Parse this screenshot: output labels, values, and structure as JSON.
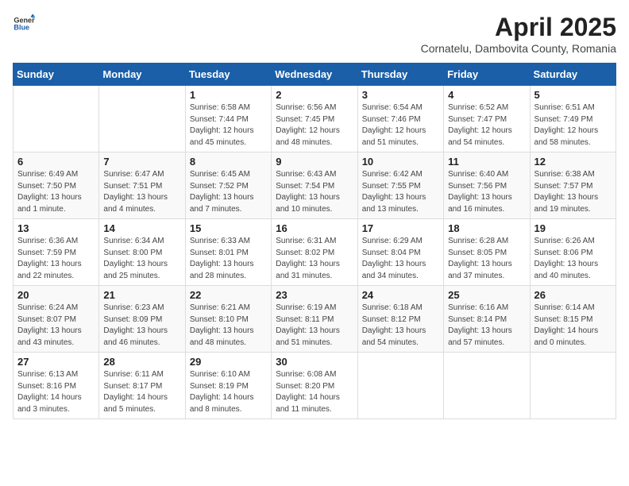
{
  "logo": {
    "general": "General",
    "blue": "Blue"
  },
  "title": {
    "month_year": "April 2025",
    "location": "Cornatelu, Dambovita County, Romania"
  },
  "weekdays": [
    "Sunday",
    "Monday",
    "Tuesday",
    "Wednesday",
    "Thursday",
    "Friday",
    "Saturday"
  ],
  "weeks": [
    [
      {
        "day": "",
        "detail": ""
      },
      {
        "day": "",
        "detail": ""
      },
      {
        "day": "1",
        "detail": "Sunrise: 6:58 AM\nSunset: 7:44 PM\nDaylight: 12 hours\nand 45 minutes."
      },
      {
        "day": "2",
        "detail": "Sunrise: 6:56 AM\nSunset: 7:45 PM\nDaylight: 12 hours\nand 48 minutes."
      },
      {
        "day": "3",
        "detail": "Sunrise: 6:54 AM\nSunset: 7:46 PM\nDaylight: 12 hours\nand 51 minutes."
      },
      {
        "day": "4",
        "detail": "Sunrise: 6:52 AM\nSunset: 7:47 PM\nDaylight: 12 hours\nand 54 minutes."
      },
      {
        "day": "5",
        "detail": "Sunrise: 6:51 AM\nSunset: 7:49 PM\nDaylight: 12 hours\nand 58 minutes."
      }
    ],
    [
      {
        "day": "6",
        "detail": "Sunrise: 6:49 AM\nSunset: 7:50 PM\nDaylight: 13 hours\nand 1 minute."
      },
      {
        "day": "7",
        "detail": "Sunrise: 6:47 AM\nSunset: 7:51 PM\nDaylight: 13 hours\nand 4 minutes."
      },
      {
        "day": "8",
        "detail": "Sunrise: 6:45 AM\nSunset: 7:52 PM\nDaylight: 13 hours\nand 7 minutes."
      },
      {
        "day": "9",
        "detail": "Sunrise: 6:43 AM\nSunset: 7:54 PM\nDaylight: 13 hours\nand 10 minutes."
      },
      {
        "day": "10",
        "detail": "Sunrise: 6:42 AM\nSunset: 7:55 PM\nDaylight: 13 hours\nand 13 minutes."
      },
      {
        "day": "11",
        "detail": "Sunrise: 6:40 AM\nSunset: 7:56 PM\nDaylight: 13 hours\nand 16 minutes."
      },
      {
        "day": "12",
        "detail": "Sunrise: 6:38 AM\nSunset: 7:57 PM\nDaylight: 13 hours\nand 19 minutes."
      }
    ],
    [
      {
        "day": "13",
        "detail": "Sunrise: 6:36 AM\nSunset: 7:59 PM\nDaylight: 13 hours\nand 22 minutes."
      },
      {
        "day": "14",
        "detail": "Sunrise: 6:34 AM\nSunset: 8:00 PM\nDaylight: 13 hours\nand 25 minutes."
      },
      {
        "day": "15",
        "detail": "Sunrise: 6:33 AM\nSunset: 8:01 PM\nDaylight: 13 hours\nand 28 minutes."
      },
      {
        "day": "16",
        "detail": "Sunrise: 6:31 AM\nSunset: 8:02 PM\nDaylight: 13 hours\nand 31 minutes."
      },
      {
        "day": "17",
        "detail": "Sunrise: 6:29 AM\nSunset: 8:04 PM\nDaylight: 13 hours\nand 34 minutes."
      },
      {
        "day": "18",
        "detail": "Sunrise: 6:28 AM\nSunset: 8:05 PM\nDaylight: 13 hours\nand 37 minutes."
      },
      {
        "day": "19",
        "detail": "Sunrise: 6:26 AM\nSunset: 8:06 PM\nDaylight: 13 hours\nand 40 minutes."
      }
    ],
    [
      {
        "day": "20",
        "detail": "Sunrise: 6:24 AM\nSunset: 8:07 PM\nDaylight: 13 hours\nand 43 minutes."
      },
      {
        "day": "21",
        "detail": "Sunrise: 6:23 AM\nSunset: 8:09 PM\nDaylight: 13 hours\nand 46 minutes."
      },
      {
        "day": "22",
        "detail": "Sunrise: 6:21 AM\nSunset: 8:10 PM\nDaylight: 13 hours\nand 48 minutes."
      },
      {
        "day": "23",
        "detail": "Sunrise: 6:19 AM\nSunset: 8:11 PM\nDaylight: 13 hours\nand 51 minutes."
      },
      {
        "day": "24",
        "detail": "Sunrise: 6:18 AM\nSunset: 8:12 PM\nDaylight: 13 hours\nand 54 minutes."
      },
      {
        "day": "25",
        "detail": "Sunrise: 6:16 AM\nSunset: 8:14 PM\nDaylight: 13 hours\nand 57 minutes."
      },
      {
        "day": "26",
        "detail": "Sunrise: 6:14 AM\nSunset: 8:15 PM\nDaylight: 14 hours\nand 0 minutes."
      }
    ],
    [
      {
        "day": "27",
        "detail": "Sunrise: 6:13 AM\nSunset: 8:16 PM\nDaylight: 14 hours\nand 3 minutes."
      },
      {
        "day": "28",
        "detail": "Sunrise: 6:11 AM\nSunset: 8:17 PM\nDaylight: 14 hours\nand 5 minutes."
      },
      {
        "day": "29",
        "detail": "Sunrise: 6:10 AM\nSunset: 8:19 PM\nDaylight: 14 hours\nand 8 minutes."
      },
      {
        "day": "30",
        "detail": "Sunrise: 6:08 AM\nSunset: 8:20 PM\nDaylight: 14 hours\nand 11 minutes."
      },
      {
        "day": "",
        "detail": ""
      },
      {
        "day": "",
        "detail": ""
      },
      {
        "day": "",
        "detail": ""
      }
    ]
  ]
}
